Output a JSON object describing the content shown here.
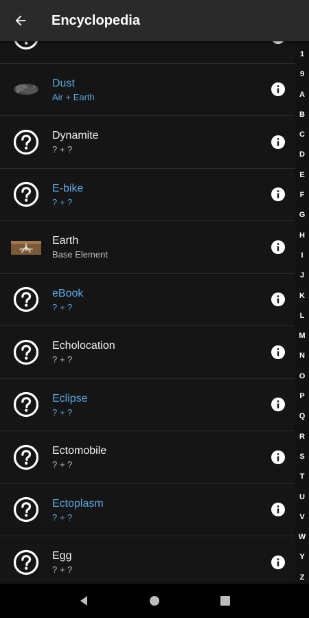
{
  "header": {
    "title": "Encyclopedia",
    "back_icon": "arrow-back-icon"
  },
  "colors": {
    "background": "#151515",
    "appbar": "#2a2a2a",
    "discovered_text": "#5aa7e0",
    "undiscovered_text": "#f0f0f0"
  },
  "items": [
    {
      "name": "",
      "recipe": "? + ?",
      "icon": "question-icon",
      "discovered": false
    },
    {
      "name": "Dust",
      "recipe": "Air + Earth",
      "icon": "dust-icon",
      "discovered": true
    },
    {
      "name": "Dynamite",
      "recipe": "? + ?",
      "icon": "question-icon",
      "discovered": false
    },
    {
      "name": "E-bike",
      "recipe": "? + ?",
      "icon": "question-icon",
      "discovered": true
    },
    {
      "name": "Earth",
      "recipe": "Base Element",
      "icon": "earth-icon",
      "discovered": false
    },
    {
      "name": "eBook",
      "recipe": "? + ?",
      "icon": "question-icon",
      "discovered": true
    },
    {
      "name": "Echolocation",
      "recipe": "? + ?",
      "icon": "question-icon",
      "discovered": false
    },
    {
      "name": "Eclipse",
      "recipe": "? + ?",
      "icon": "question-icon",
      "discovered": true
    },
    {
      "name": "Ectomobile",
      "recipe": "? + ?",
      "icon": "question-icon",
      "discovered": false
    },
    {
      "name": "Ectoplasm",
      "recipe": "? + ?",
      "icon": "question-icon",
      "discovered": true
    },
    {
      "name": "Egg",
      "recipe": "? + ?",
      "icon": "question-icon",
      "discovered": false
    }
  ],
  "index_letters": [
    "1",
    "9",
    "A",
    "B",
    "C",
    "D",
    "E",
    "F",
    "G",
    "H",
    "I",
    "J",
    "K",
    "L",
    "M",
    "N",
    "O",
    "P",
    "Q",
    "R",
    "S",
    "T",
    "U",
    "V",
    "W",
    "Y",
    "Z"
  ],
  "navigation": {
    "back_icon": "nav-back-icon",
    "home_icon": "nav-home-icon",
    "recents_icon": "nav-recents-icon"
  }
}
